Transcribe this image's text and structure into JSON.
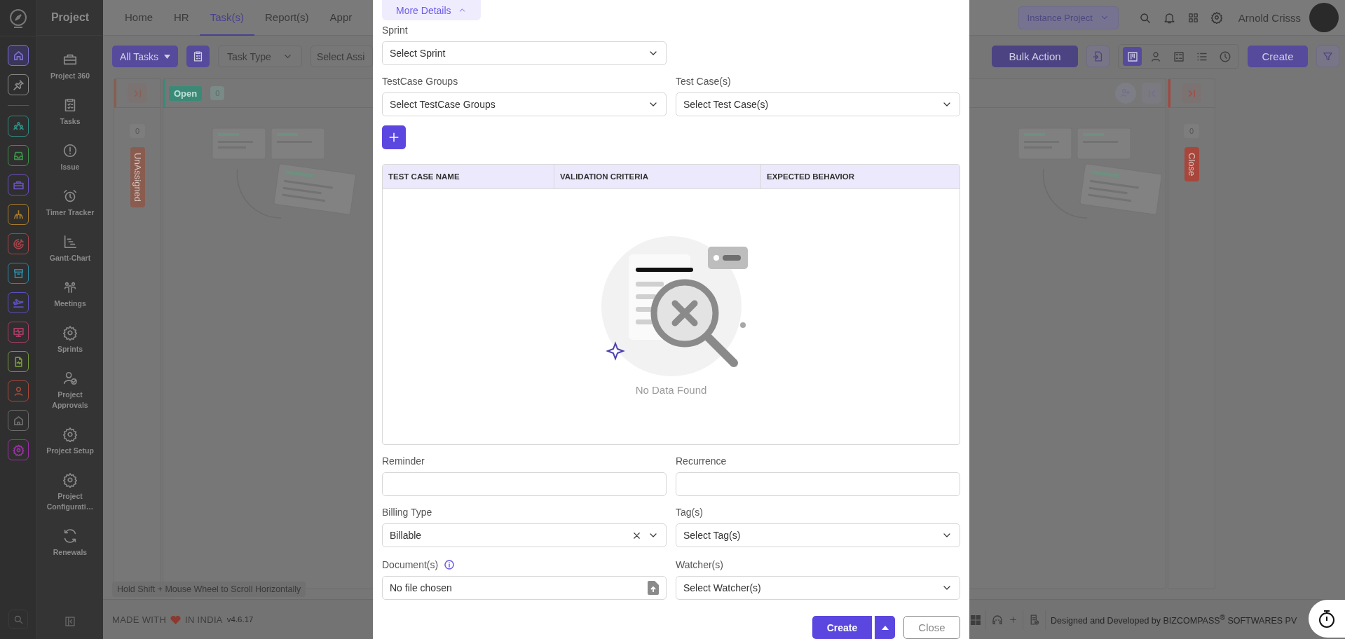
{
  "rail": {
    "items": [
      {
        "kind": "home",
        "color": "#7b6fd0",
        "selected": true
      },
      {
        "kind": "pin",
        "color": "#8a8a8a",
        "selected": false
      },
      {
        "kind": "people",
        "color": "#2f8a80",
        "selected": false
      },
      {
        "kind": "inbox",
        "color": "#3d8f4a",
        "selected": false
      },
      {
        "kind": "briefcase",
        "color": "#6a4fbf",
        "selected": false
      },
      {
        "kind": "hands",
        "color": "#a77a2c",
        "selected": false
      },
      {
        "kind": "target",
        "color": "#a8434c",
        "selected": false
      },
      {
        "kind": "archive",
        "color": "#2e87a0",
        "selected": false
      },
      {
        "kind": "plane",
        "color": "#5a4fbd",
        "selected": false
      },
      {
        "kind": "monitor",
        "color": "#a63d66",
        "selected": false
      },
      {
        "kind": "file",
        "color": "#76993a",
        "selected": false
      },
      {
        "kind": "person",
        "color": "#a8473a",
        "selected": false
      },
      {
        "kind": "house",
        "color": "#6c6c6c",
        "selected": false
      },
      {
        "kind": "gear",
        "color": "#9c2fa8",
        "selected": false
      }
    ]
  },
  "nav": {
    "title": "Project",
    "items": [
      {
        "label": "Project 360",
        "kind": "briefcase"
      },
      {
        "label": "Tasks",
        "kind": "clipboard"
      },
      {
        "label": "Issue",
        "kind": "alert"
      },
      {
        "label": "Timer Tracker",
        "kind": "alarm"
      },
      {
        "label": "Gantt-Chart",
        "kind": "gantt"
      },
      {
        "label": "Meetings",
        "kind": "meeting"
      },
      {
        "label": "Sprints",
        "kind": "gear"
      },
      {
        "label": "Project Approvals",
        "kind": "user-check"
      },
      {
        "label": "Project Setup",
        "kind": "gear"
      },
      {
        "label": "Project Configurati…",
        "kind": "gear"
      },
      {
        "label": "Renewals",
        "kind": "refresh"
      }
    ]
  },
  "header": {
    "tabs": [
      {
        "label": "Home",
        "selected": false
      },
      {
        "label": "HR",
        "selected": false
      },
      {
        "label": "Task(s)",
        "selected": true
      },
      {
        "label": "Report(s)",
        "selected": false
      },
      {
        "label": "Appr",
        "selected": false
      }
    ],
    "project_select": "Instance Project",
    "user_name": "Arnold Crisss"
  },
  "toolbar": {
    "task_filter": "All Tasks",
    "task_type": "Task Type",
    "assignee": "Select Assi",
    "bulk_action": "Bulk Action",
    "views": [
      {
        "kind": "board",
        "selected": true
      },
      {
        "kind": "person",
        "selected": false
      },
      {
        "kind": "form",
        "selected": false
      },
      {
        "kind": "list",
        "selected": false
      },
      {
        "kind": "clock",
        "selected": false
      }
    ],
    "create": "Create"
  },
  "board": {
    "columns": [
      {
        "kind": "collapsed",
        "title": "UnAssigned",
        "count": "0",
        "color": "#8a5c4f"
      },
      {
        "kind": "open",
        "title": "Open",
        "count": "0",
        "color": "#3b8a77"
      },
      {
        "kind": "headless"
      },
      {
        "kind": "collapsed",
        "title": "Close",
        "count": "0",
        "color": "#a8463c"
      }
    ],
    "hint": "Hold Shift + Mouse Wheel to Scroll Horizontally"
  },
  "footer": {
    "made_with": "MADE WITH",
    "in_india": "IN INDIA",
    "version": "v4.6.17",
    "credit": "Designed and Developed by  BIZCOMPASS$^{®}$ SOFTWARES PV"
  },
  "modal": {
    "section_toggle": {
      "label": "More Details",
      "expanded": true
    },
    "sprint": {
      "label": "Sprint",
      "placeholder": "Select Sprint"
    },
    "testcase_groups": {
      "label": "TestCase Groups",
      "placeholder": "Select TestCase Groups"
    },
    "test_cases": {
      "label": "Test Case(s)",
      "placeholder": "Select Test Case(s)"
    },
    "table": {
      "columns": [
        "TEST CASE NAME",
        "VALIDATION CRITERIA",
        "EXPECTED BEHAVIOR"
      ],
      "empty_text": "No Data Found"
    },
    "reminder": {
      "label": "Reminder"
    },
    "recurrence": {
      "label": "Recurrence"
    },
    "billing_type": {
      "label": "Billing Type",
      "value": "Billable"
    },
    "tags": {
      "label": "Tag(s)",
      "placeholder": "Select Tag(s)"
    },
    "documents": {
      "label": "Document(s)",
      "file_text": "No file chosen"
    },
    "watchers": {
      "label": "Watcher(s)",
      "placeholder": "Select Watcher(s)"
    },
    "buttons": {
      "create": "Create",
      "close": "Close"
    }
  }
}
